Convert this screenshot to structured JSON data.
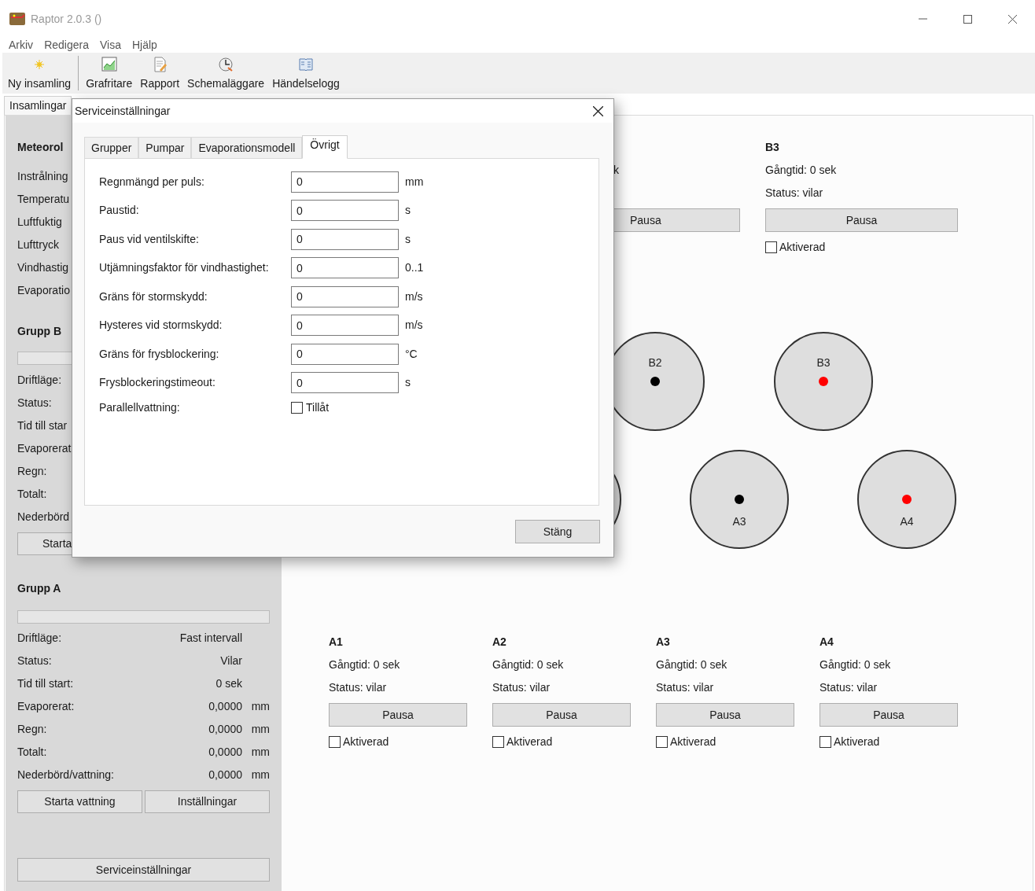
{
  "window": {
    "title": "Raptor 2.0.3 ()"
  },
  "menu": [
    "Arkiv",
    "Redigera",
    "Visa",
    "Hjälp"
  ],
  "toolbar": [
    {
      "label": "Ny insamling"
    },
    {
      "label": "Grafritare"
    },
    {
      "label": "Rapport"
    },
    {
      "label": "Schemaläggare"
    },
    {
      "label": "Händelselogg"
    }
  ],
  "main_tabs": [
    {
      "label": "Insamlingar"
    }
  ],
  "side_panel": {
    "meteorology": {
      "title": "Meteorol",
      "rows": [
        "Instrålning",
        "Temperatu",
        "Luftfuktig",
        "Lufttryck",
        "Vindhastig",
        "Evaporatio"
      ]
    },
    "group_b": {
      "title": "Grupp B",
      "progress": {
        "level": 0
      },
      "rows": [
        {
          "label": "Driftläge:"
        },
        {
          "label": "Status:"
        },
        {
          "label": "Tid till star"
        },
        {
          "label": "Evaporerat"
        },
        {
          "label": "Regn:"
        },
        {
          "label": "Totalt:"
        },
        {
          "label": "Nederbörd"
        }
      ],
      "buttons": [
        "Starta"
      ]
    },
    "group_a": {
      "title": "Grupp A",
      "progress": {
        "level": 0
      },
      "rows": [
        {
          "label": "Driftläge:",
          "value": "Fast intervall"
        },
        {
          "label": "Status:",
          "value": "Vilar"
        },
        {
          "label": "Tid till start:",
          "value": "0 sek"
        },
        {
          "label": "Evaporerat:",
          "value": "0,0000",
          "unit": "mm"
        },
        {
          "label": "Regn:",
          "value": "0,0000",
          "unit": "mm"
        },
        {
          "label": "Totalt:",
          "value": "0,0000",
          "unit": "mm"
        },
        {
          "label": "Nederbörd/vattning:",
          "value": "0,0000",
          "unit": "mm"
        }
      ],
      "buttons": [
        "Starta vattning",
        "Inställningar"
      ]
    },
    "service_button": "Serviceinställningar"
  },
  "b_pumps": [
    {
      "runtime": "k",
      "button": "Pausa"
    },
    {
      "title": "B3",
      "runtime": "Gångtid: 0 sek",
      "status": "Status: vilar",
      "button": "Pausa",
      "activated": {
        "label": "Aktiverad",
        "checked": false
      }
    }
  ],
  "a_pumps": [
    {
      "title": "A1",
      "runtime": "Gångtid: 0 sek",
      "status": "Status: vilar",
      "button": "Pausa",
      "activated": {
        "label": "Aktiverad",
        "checked": false
      }
    },
    {
      "title": "A2",
      "runtime": "Gångtid: 0 sek",
      "status": "Status: vilar",
      "button": "Pausa",
      "activated": {
        "label": "Aktiverad",
        "checked": false
      }
    },
    {
      "title": "A3",
      "runtime": "Gångtid: 0 sek",
      "status": "Status: vilar",
      "button": "Pausa",
      "activated": {
        "label": "Aktiverad",
        "checked": false
      }
    },
    {
      "title": "A4",
      "runtime": "Gångtid: 0 sek",
      "status": "Status: vilar",
      "button": "Pausa",
      "activated": {
        "label": "Aktiverad",
        "checked": false
      }
    }
  ],
  "diagram": {
    "rows": [
      {
        "circles": [
          {
            "kind": "pump",
            "label": "B2",
            "color": "#000000"
          },
          {
            "kind": "pump",
            "label": "B3",
            "color": "#ff0000"
          }
        ]
      },
      {
        "circles": [
          {
            "kind": "edge"
          },
          {
            "kind": "pump",
            "label": "A3",
            "color": "#000000"
          },
          {
            "kind": "pump",
            "label": "A4",
            "color": "#ff0000"
          }
        ]
      }
    ]
  },
  "dialog": {
    "title": "Serviceinställningar",
    "tabs": [
      {
        "label": "Grupper",
        "selected": false
      },
      {
        "label": "Pumpar",
        "selected": false
      },
      {
        "label": "Evaporationsmodell",
        "selected": false
      },
      {
        "label": "Övrigt",
        "selected": true
      }
    ],
    "fields": [
      {
        "label": "Regnmängd per puls:",
        "value": "0",
        "unit": "mm"
      },
      {
        "label": "Paustid:",
        "value": "0",
        "unit": "s"
      },
      {
        "label": "Paus vid ventilskifte:",
        "value": "0",
        "unit": "s"
      },
      {
        "label": "Utjämningsfaktor för vindhastighet:",
        "value": "0",
        "unit": "0..1"
      },
      {
        "label": "Gräns för stormskydd:",
        "value": "0",
        "unit": "m/s"
      },
      {
        "label": "Hysteres vid stormskydd:",
        "value": "0",
        "unit": "m/s"
      },
      {
        "label": "Gräns för frysblockering:",
        "value": "0",
        "unit": "°C"
      },
      {
        "label": "Frysblockeringstimeout:",
        "value": "0",
        "unit": "s"
      }
    ],
    "checkbox": {
      "label": "Parallellvattning:",
      "option": "Tillåt",
      "checked": false
    },
    "close_button": "Stäng"
  }
}
